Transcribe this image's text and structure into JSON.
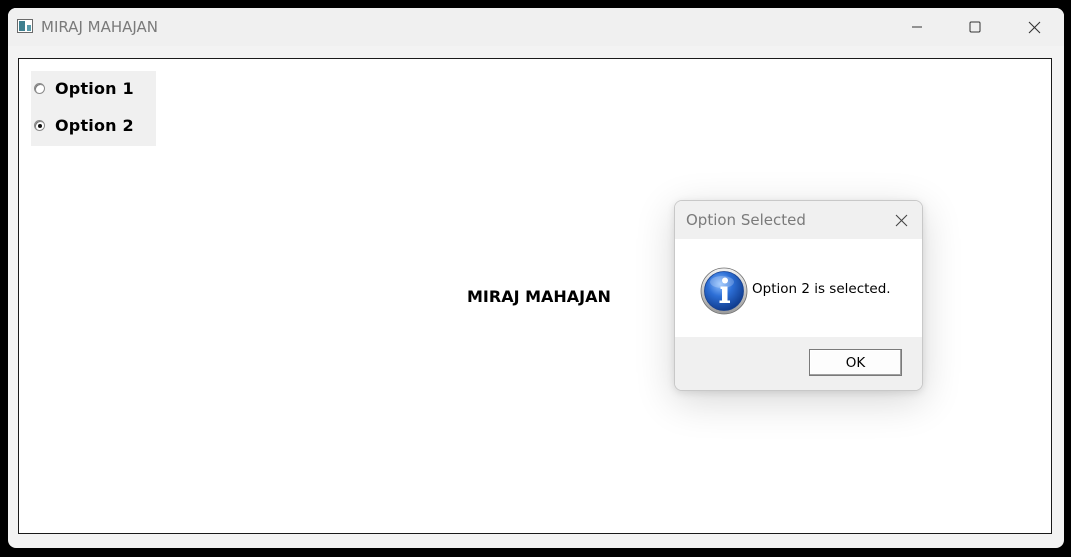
{
  "window": {
    "title": "MIRAJ MAHAJAN",
    "controls": {
      "minimize_icon": "minimize-icon",
      "maximize_icon": "maximize-icon",
      "close_icon": "close-icon"
    }
  },
  "radio_group": {
    "options": [
      {
        "label": "Option 1",
        "selected": false
      },
      {
        "label": "Option 2",
        "selected": true
      }
    ]
  },
  "main": {
    "label": "MIRAJ MAHAJAN"
  },
  "dialog": {
    "title": "Option Selected",
    "icon": "info-icon",
    "message": "Option 2 is selected.",
    "ok_label": "OK"
  }
}
